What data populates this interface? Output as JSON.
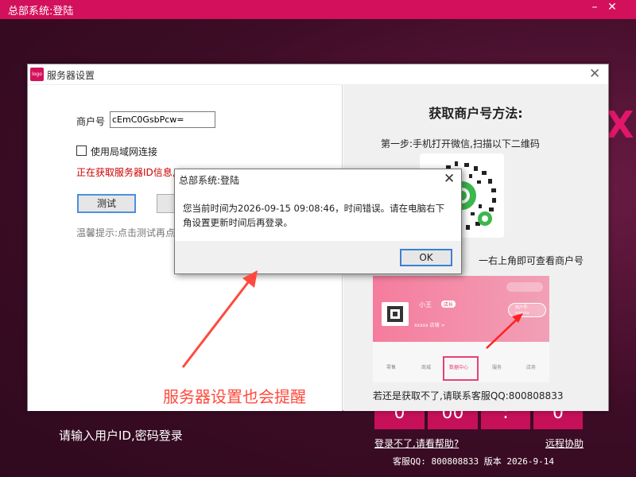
{
  "background_window": {
    "title": "总部系统:登陆",
    "minimize_glyph": "–",
    "close_glyph": "✕",
    "brand_x": "X",
    "prompt": "请输入用户ID,密码登录",
    "digits": [
      "0",
      "00",
      ":",
      "0"
    ],
    "help_link": "登录不了,请看帮助?",
    "remote_link": "远程协助",
    "footer": "客服QQ: 800808833    版本  2026-9-14"
  },
  "settings_dialog": {
    "title": "服务器设置",
    "icon_text": "logo",
    "close_glyph": "✕",
    "merchant_label": "商户号",
    "merchant_value": "cEmC0GsbPcw=",
    "lan_label": "使用局域网连接",
    "status": "正在获取服务器ID信息,",
    "test_button": "测试",
    "tip": "温馨提示:点击测试再点",
    "method_title": "获取商户号方法:",
    "step1": "第一步:手机打开微信,扫描以下二维码",
    "step2": "一右上角即可查看商户号",
    "phone": {
      "name": "小王",
      "tag": "店长",
      "id_label": "xxxxx 店铺 >",
      "badge_line1": "商户号:",
      "badge_line2": "xxxxxx",
      "nav": [
        "零售",
        "商城",
        "数据中心",
        "服务",
        "店务"
      ]
    },
    "contact": "若还是获取不了,请联系客服QQ:800808833"
  },
  "alert_dialog": {
    "title": "总部系统:登陆",
    "close_glyph": "✕",
    "message": "您当前时间为2026-09-15 09:08:46，时间错误。请在电脑右下角设置更新时间后再登录。",
    "ok_button": "OK"
  },
  "annotation": {
    "text": "服务器设置也会提醒",
    "color": "#ff4a3d"
  },
  "colors": {
    "brand": "#d3105c",
    "background": "#3d0c26",
    "status_red": "#cc0000",
    "focus_blue": "#3c7fd8"
  }
}
